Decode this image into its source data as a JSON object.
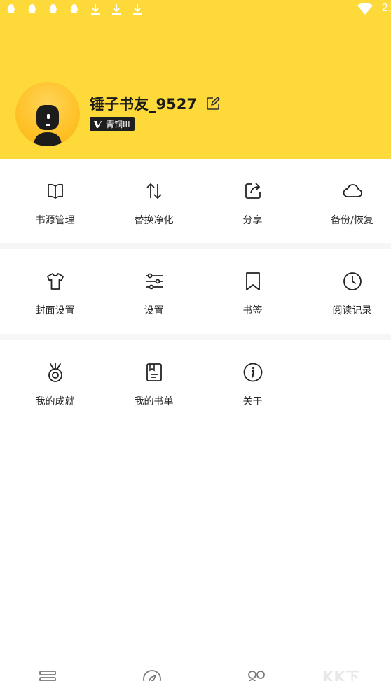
{
  "status_bar": {
    "time": "2:",
    "notification_icons": [
      "qq-icon",
      "qq-icon",
      "qq-icon",
      "qq-icon",
      "download-icon",
      "download-icon",
      "download-icon"
    ],
    "wifi_icon": "wifi-icon"
  },
  "profile": {
    "username": "锤子书友_9527",
    "badge_label": "青铜III",
    "header_color": "#fdd93a",
    "avatar_color": "#ffc126"
  },
  "menu_section_1": [
    {
      "label": "书源管理",
      "icon": "book-open-icon"
    },
    {
      "label": "替换净化",
      "icon": "swap-arrows-icon"
    },
    {
      "label": "分享",
      "icon": "share-icon"
    },
    {
      "label": "备份/恢复",
      "icon": "cloud-icon"
    }
  ],
  "menu_section_2": [
    {
      "label": "封面设置",
      "icon": "shirt-icon"
    },
    {
      "label": "设置",
      "icon": "sliders-icon"
    },
    {
      "label": "书签",
      "icon": "bookmark-icon"
    },
    {
      "label": "阅读记录",
      "icon": "clock-icon"
    }
  ],
  "menu_section_3": [
    {
      "label": "我的成就",
      "icon": "medal-icon"
    },
    {
      "label": "我的书单",
      "icon": "booklist-icon"
    },
    {
      "label": "关于",
      "icon": "info-icon"
    }
  ],
  "bottom_nav": {
    "icons": [
      "bookshelf-icon",
      "compass-icon",
      "grid-icon"
    ]
  },
  "watermark": "KK下"
}
